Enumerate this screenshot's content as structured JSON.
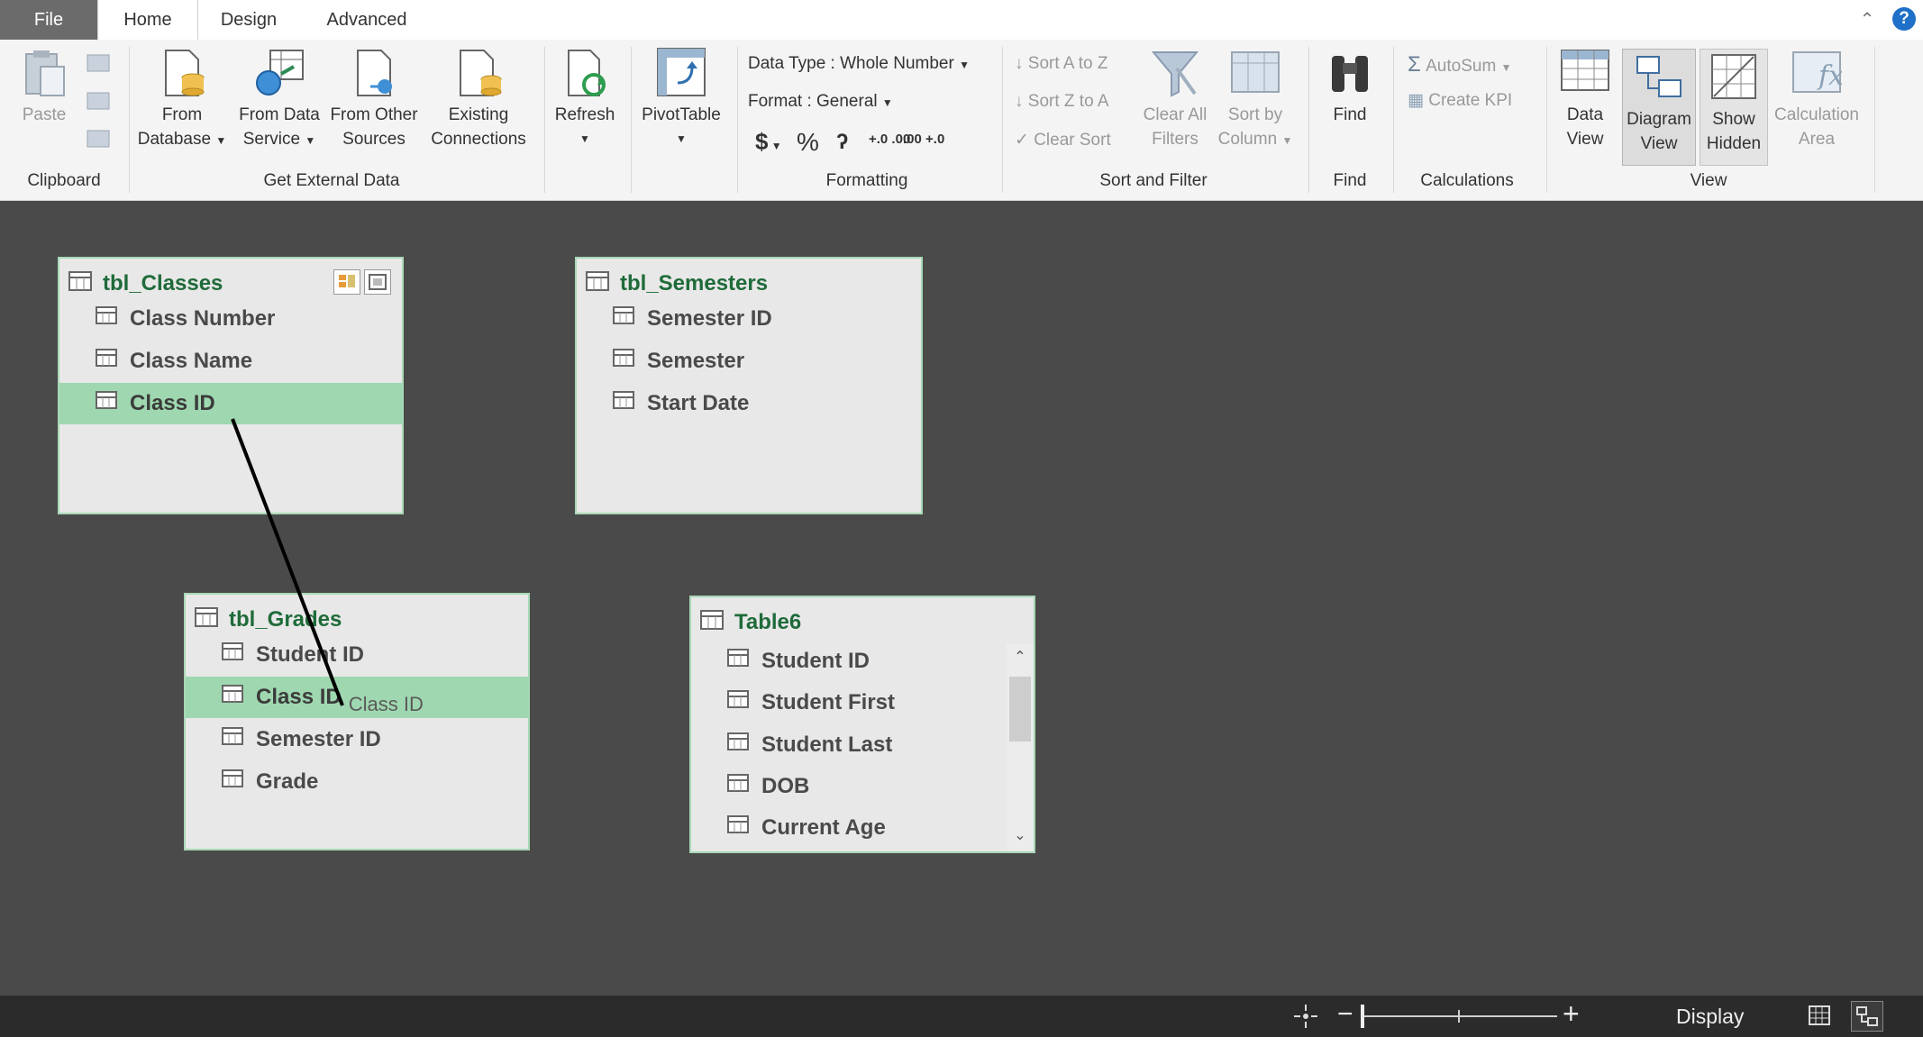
{
  "tabs": {
    "file": "File",
    "home": "Home",
    "design": "Design",
    "advanced": "Advanced"
  },
  "ribbon": {
    "clipboard": {
      "paste": "Paste",
      "group": "Clipboard"
    },
    "external": {
      "from_database": [
        "From",
        "Database"
      ],
      "from_data_service": [
        "From Data",
        "Service"
      ],
      "from_other_sources": [
        "From Other",
        "Sources"
      ],
      "existing_connections": [
        "Existing",
        "Connections"
      ],
      "group": "Get External Data"
    },
    "refresh": "Refresh",
    "pivottable": "PivotTable",
    "formatting": {
      "data_type": "Data Type : Whole Number",
      "format": "Format : General",
      "currency": "$",
      "percent": "%",
      "comma": "ʔ",
      "inc_decimal": "+.0 .00",
      "dec_decimal": ".00 +.0",
      "group": "Formatting"
    },
    "sort": {
      "sort_az": "Sort A to Z",
      "sort_za": "Sort Z to A",
      "clear_sort": "Clear Sort",
      "clear_all_filters": [
        "Clear All",
        "Filters"
      ],
      "sort_by_column": [
        "Sort by",
        "Column"
      ],
      "group": "Sort and Filter"
    },
    "find": {
      "label": "Find",
      "group": "Find"
    },
    "calculations": {
      "autosum": "AutoSum",
      "create_kpi": "Create KPI",
      "group": "Calculations"
    },
    "view": {
      "data_view": [
        "Data",
        "View"
      ],
      "diagram_view": [
        "Diagram",
        "View"
      ],
      "show_hidden": [
        "Show",
        "Hidden"
      ],
      "calculation_area": [
        "Calculation",
        "Area"
      ],
      "group": "View"
    }
  },
  "tables": {
    "classes": {
      "title": "tbl_Classes",
      "columns": [
        "Class Number",
        "Class Name",
        "Class ID"
      ],
      "selected": "Class ID"
    },
    "semesters": {
      "title": "tbl_Semesters",
      "columns": [
        "Semester ID",
        "Semester",
        "Start Date"
      ]
    },
    "grades": {
      "title": "tbl_Grades",
      "columns": [
        "Student ID",
        "Class ID",
        "Semester ID",
        "Grade"
      ],
      "selected": "Class ID",
      "drag_tooltip": "Class ID"
    },
    "table6": {
      "title": "Table6",
      "columns": [
        "Student ID",
        "Student First",
        "Student Last",
        "DOB",
        "Current Age"
      ]
    }
  },
  "statusbar": {
    "display": "Display",
    "zoom_minus": "−",
    "zoom_plus": "+"
  },
  "colors": {
    "accent_green": "#1f6b3a",
    "selected_row": "#9fd8b0",
    "canvas": "#4a4a4a",
    "table_border": "#a9d8b8"
  },
  "icons": [
    "table-icon",
    "column-icon",
    "paste-icon",
    "database-icon",
    "refresh-icon",
    "pivottable-icon",
    "filter-icon",
    "binoculars-icon",
    "sigma-icon",
    "grid-icon",
    "diagram-icon",
    "help-icon"
  ]
}
